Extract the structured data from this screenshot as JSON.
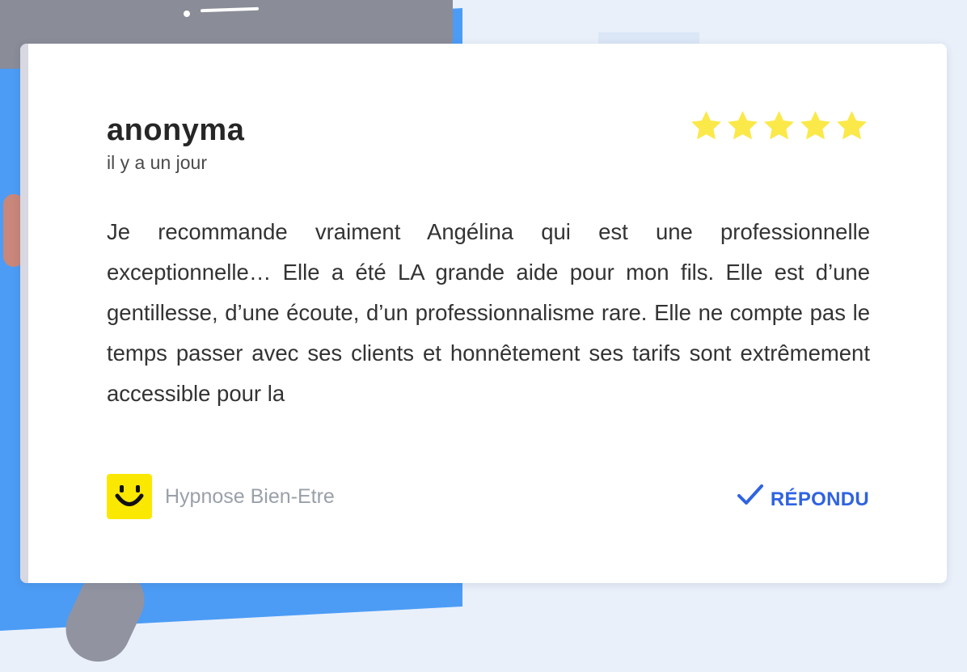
{
  "review": {
    "author": "anonyma",
    "date": "il y a un jour",
    "rating": 5,
    "rating_max": 5,
    "text": "Je recommande vraiment Angélina qui est une professionnelle exceptionnelle… Elle a été LA grande aide pour mon fils. Elle est d’une gentillesse, d’une écoute, d’un professionnalisme rare. Elle ne compte pas le temps passer avec ses clients et honnêtement ses tarifs sont extrêmement accessible pour la"
  },
  "business": {
    "name": "Hypnose Bien-Etre",
    "logo_icon": "smiley-logo-icon"
  },
  "status": {
    "label": "RÉPONDU",
    "icon": "checkmark-icon"
  },
  "colors": {
    "star": "#fbe94a",
    "accent_blue": "#2f63e0",
    "logo_yellow": "#fbe800",
    "background_blue": "#4c9cf5"
  }
}
